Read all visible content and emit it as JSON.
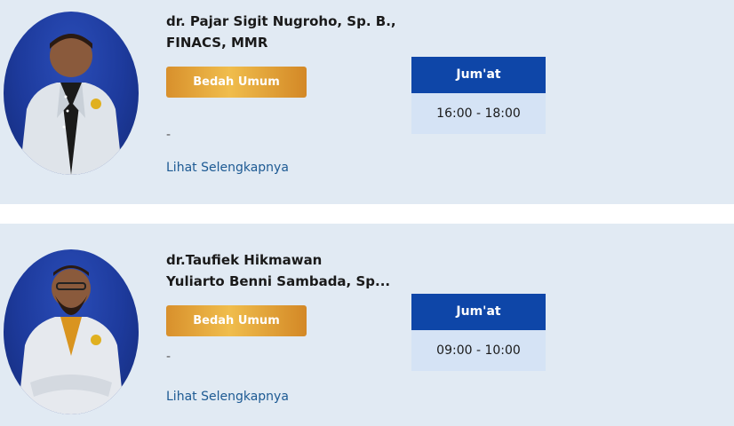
{
  "doctors": [
    {
      "name_line1": "dr. Pajar Sigit Nugroho, Sp. B.,",
      "name_line2": "FINACS, MMR",
      "specialty": "Bedah Umum",
      "note": "-",
      "more_link": "Lihat Selengkapnya",
      "schedule": {
        "day": "Jum'at",
        "time": "16:00 - 18:00"
      }
    },
    {
      "name_line1": "dr.Taufiek Hikmawan",
      "name_line2": "Yuliarto Benni Sambada, Sp...",
      "specialty": "Bedah Umum",
      "note": "-",
      "more_link": "Lihat Selengkapnya",
      "schedule": {
        "day": "Jum'at",
        "time": "09:00 - 10:00"
      }
    }
  ],
  "colors": {
    "card_bg": "#e1eaf3",
    "day_header": "#0e46a8",
    "time_cell": "#d5e3f5",
    "specialty_badge": "#e6a53a",
    "link": "#1d5a93"
  }
}
